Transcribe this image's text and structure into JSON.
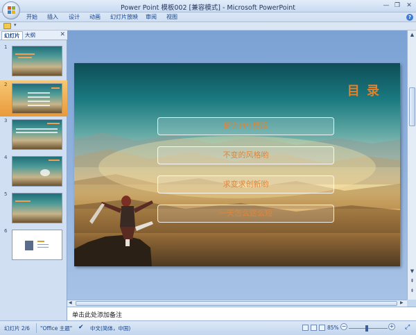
{
  "window": {
    "title": "Power Point  模板002 [兼容模式] - Microsoft PowerPoint",
    "minimize": "—",
    "maximize": "❐",
    "close": "✕"
  },
  "ribbon": {
    "tabs": [
      "开始",
      "插入",
      "设计",
      "动画",
      "幻灯片放映",
      "审阅",
      "视图"
    ],
    "help": "?"
  },
  "qat": {
    "dropdown": "▾"
  },
  "left_pane": {
    "tabs": [
      "幻灯片",
      "大纲"
    ],
    "close": "✕",
    "thumbnails": [
      {
        "num": "1"
      },
      {
        "num": "2"
      },
      {
        "num": "3"
      },
      {
        "num": "4"
      },
      {
        "num": "5"
      },
      {
        "num": "6"
      }
    ],
    "selected_index": 2
  },
  "slide": {
    "title": "目 录",
    "menu_items": [
      "研究PPT模版",
      "不变的风格哟",
      "求变求创新哟",
      "一天怎么这么短"
    ],
    "title_color": "#e3802b"
  },
  "scroll": {
    "up": "▲",
    "down": "▼",
    "prev": "⇞",
    "next": "⇟",
    "left": "◀",
    "right": "▶"
  },
  "notes": {
    "placeholder": "单击此处添加备注"
  },
  "status": {
    "slide_info": "幻灯片 2/6",
    "theme": "\"Office 主题\"",
    "language": "中文(简体，中国)",
    "zoom": "85%",
    "zoom_minus": "−",
    "zoom_plus": "+",
    "fit": "⤢"
  }
}
